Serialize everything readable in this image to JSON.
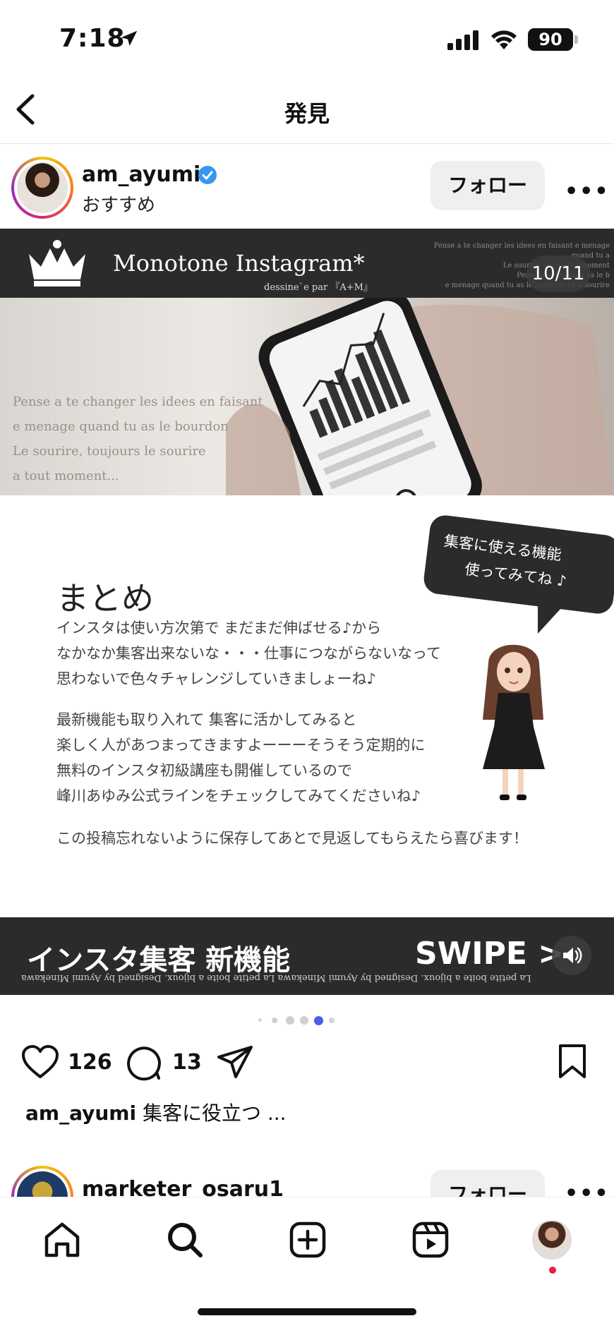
{
  "status": {
    "time": "7:18",
    "battery": "90"
  },
  "nav": {
    "title": "発見"
  },
  "post": {
    "username": "am_ayumi",
    "subtitle": "おすすめ",
    "follow_label": "フォロー",
    "counter": "10/11",
    "banner_title": "Monotone Instagram*",
    "banner_sub": "dessine`e par 『A+M』",
    "ghost_text": [
      "Pense a te changer les idees en faisant  e menage quand tu a",
      "Le sourire, toujours l  moment",
      "Pense a te chang  u as le b",
      "e menage quand tu as le bourdon Le s  sourire"
    ],
    "photo_phrase": [
      "Pense a te changer les idees en faisant",
      "e menage quand tu as le bourdon",
      "Le sourire, toujours le sourire",
      " a tout moment..."
    ],
    "summary_title": "まとめ",
    "bubble": [
      "集客に使える機能",
      "使ってみてね ♪"
    ],
    "para1": [
      "インスタは使い方次第で まだまだ伸ばせる♪から",
      "なかなか集客出来ないな・・・仕事につながらないなって",
      "思わないで色々チャレンジしていきましょーね♪"
    ],
    "para2": [
      "最新機能も取り入れて 集客に活かしてみると",
      "楽しく人があつまってきますよーーーそうそう定期的に",
      "無料のインスタ初級講座も開催しているので",
      "峰川あゆみ公式ラインをチェックしてみてくださいね♪"
    ],
    "para3": "この投稿忘れないように保存してあとで見返してもらえたら喜びます！",
    "footer_left": "インスタ集客 新機能",
    "footer_right": "SWIPE >",
    "footer_mirror": "La petite boite a bijoux.   Designed by   Ayumi Minekawa   La petite boite a bijoux.   Designed by   Ayumi Minekawa",
    "likes": "126",
    "comments": "13",
    "caption_user": "am_ayumi",
    "caption_text": " 集客に役立つ ..."
  },
  "next_post": {
    "username": "marketer_osaru1",
    "follow_label": "フォロー"
  },
  "colors": {
    "accent_dot": "#4d5de6",
    "verified": "#3897f0",
    "banner": "#2b2b2b"
  }
}
